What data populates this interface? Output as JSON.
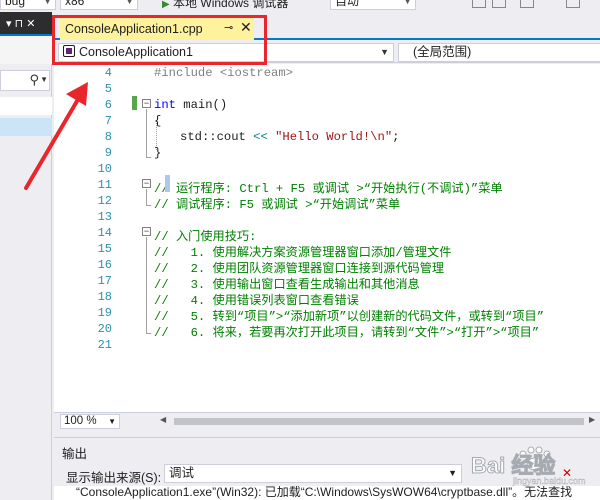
{
  "toolbar": {
    "config_value": "bug",
    "platform_value": "x86",
    "run_label": "本地 Windows 调试器",
    "run_mode": "自动"
  },
  "tab": {
    "title": "ConsoleApplication1.cpp",
    "pin_icon": "pin-icon",
    "close_icon": "close-icon"
  },
  "navbar": {
    "project": "ConsoleApplication1",
    "scope": "(全局范围)"
  },
  "editor": {
    "lines": [
      {
        "n": "4",
        "text": "#include <iostream>"
      },
      {
        "n": "5",
        "text": ""
      },
      {
        "n": "6",
        "text": "int main()"
      },
      {
        "n": "7",
        "text": "{"
      },
      {
        "n": "8",
        "text": "    std::cout << \"Hello World!\\n\";"
      },
      {
        "n": "9",
        "text": "}"
      },
      {
        "n": "10",
        "text": ""
      },
      {
        "n": "11",
        "text": "// 运行程序: Ctrl + F5 或调试 >“开始执行(不调试)”菜单"
      },
      {
        "n": "12",
        "text": "// 调试程序: F5 或调试 >“开始调试”菜单"
      },
      {
        "n": "13",
        "text": ""
      },
      {
        "n": "14",
        "text": "// 入门使用技巧:"
      },
      {
        "n": "15",
        "text": "//   1. 使用解决方案资源管理器窗口添加/管理文件"
      },
      {
        "n": "16",
        "text": "//   2. 使用团队资源管理器窗口连接到源代码管理"
      },
      {
        "n": "17",
        "text": "//   3. 使用输出窗口查看生成输出和其他消息"
      },
      {
        "n": "18",
        "text": "//   4. 使用错误列表窗口查看错误"
      },
      {
        "n": "19",
        "text": "//   5. 转到“项目”>“添加新项”以创建新的代码文件，或转到“项目”"
      },
      {
        "n": "20",
        "text": "//   6. 将来，若要再次打开此项目，请转到“文件”>“打开”>“项目”"
      },
      {
        "n": "21",
        "text": ""
      }
    ]
  },
  "zoom": {
    "value": "100 %"
  },
  "output": {
    "title": "输出",
    "source_label": "显示输出来源(S):",
    "source_value": "调试",
    "message": "“ConsoleApplication1.exe”(Win32): 已加载“C:\\Windows\\SysWOW64\\cryptbase.dll”。无法查找"
  },
  "watermark": {
    "text": "Bai 经验",
    "sub": "jingyan.baidu.com"
  },
  "colors": {
    "accent_blue": "#007ACC",
    "tab_yellow": "#FFF29D",
    "annotation_red": "#E8262B",
    "keyword": "#0000FF",
    "string": "#A31515",
    "comment": "#008000",
    "line_number": "#2B91AF"
  }
}
